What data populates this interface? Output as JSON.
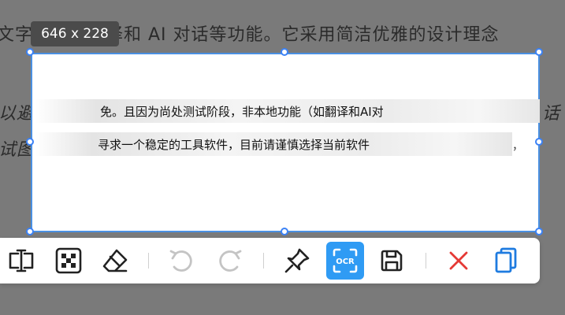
{
  "background": {
    "line1": "文字识别、翻译和 AI 对话等功能。它采用简洁优雅的设计理念",
    "line2_left": "以避",
    "line2_right": "话",
    "line3_left": "试图"
  },
  "selection": {
    "size_label": "646 x 228"
  },
  "ocr_lines": [
    "免。且因为尚处测试阶段，非本地功能（如翻译和AI对",
    "寻求一个稳定的工具软件，目前请谨慎选择当前软件"
  ],
  "stray_char": "，",
  "toolbar": {
    "tools": [
      {
        "icon": "text-cursor-icon"
      },
      {
        "icon": "mosaic-icon"
      },
      {
        "icon": "eraser-icon"
      },
      {
        "icon": "undo-icon"
      },
      {
        "icon": "redo-icon"
      },
      {
        "icon": "pin-icon"
      },
      {
        "icon": "ocr-icon",
        "active": true
      },
      {
        "icon": "save-icon"
      },
      {
        "icon": "close-icon"
      },
      {
        "icon": "copy-icon"
      }
    ],
    "ocr_text": "OCR"
  },
  "colors": {
    "accent": "#2f9bf4",
    "selection_border": "#4a90e2",
    "close": "#e53935",
    "overlay": "#7a7a7a"
  }
}
